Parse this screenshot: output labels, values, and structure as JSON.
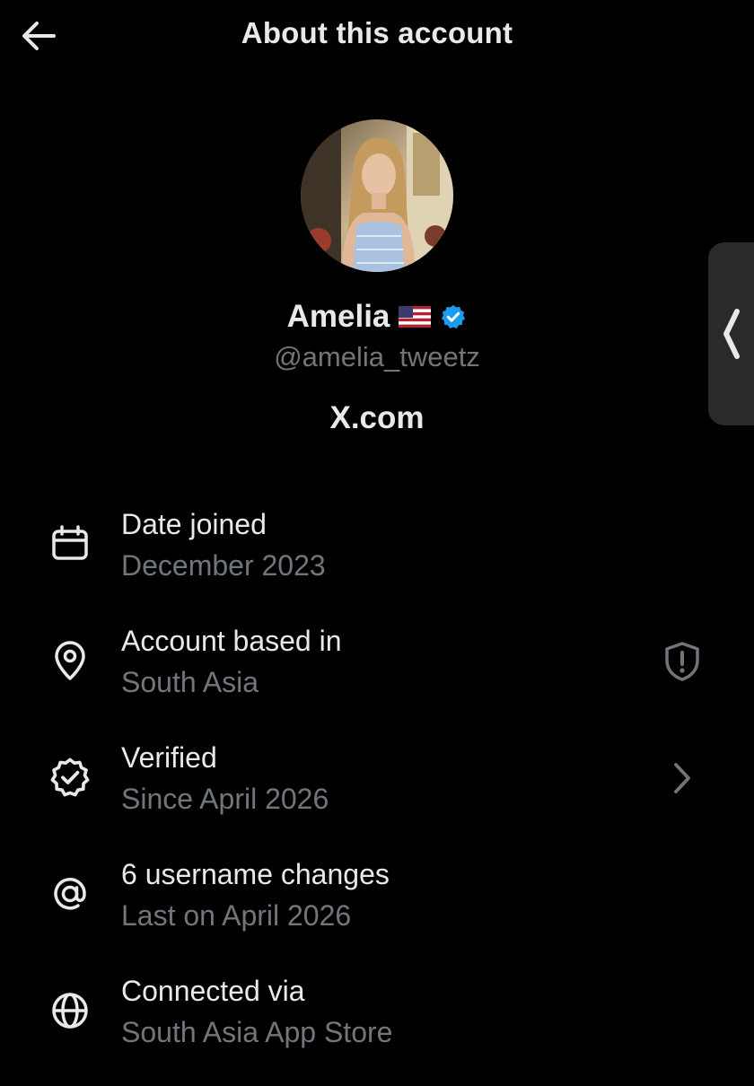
{
  "header": {
    "title": "About this account"
  },
  "profile": {
    "display_name": "Amelia",
    "flag_icon": "us-flag-icon",
    "handle": "@amelia_tweetz",
    "website": "X.com",
    "verified_color": "#1d9bf0"
  },
  "rows": [
    {
      "icon": "calendar-icon",
      "title": "Date joined",
      "subtitle": "December 2023"
    },
    {
      "icon": "location-pin-icon",
      "title": "Account based in",
      "subtitle": "South Asia",
      "trailing_icon": "shield-alert-icon"
    },
    {
      "icon": "verified-badge-icon",
      "title": "Verified",
      "subtitle": "Since April 2026",
      "trailing_icon": "chevron-right-icon"
    },
    {
      "icon": "at-sign-icon",
      "title": "6 username changes",
      "subtitle": "Last on April 2026"
    },
    {
      "icon": "globe-icon",
      "title": "Connected via",
      "subtitle": "South Asia App Store"
    }
  ],
  "colors": {
    "background": "#000000",
    "primary_text": "#e7e9ea",
    "secondary_text": "#71767b",
    "accent": "#1d9bf0"
  }
}
